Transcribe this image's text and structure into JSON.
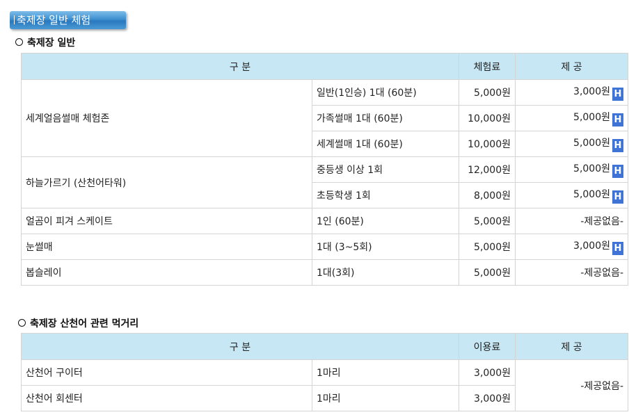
{
  "title": "축제장 일반 체험",
  "section1": {
    "heading": "축제장 일반",
    "headers": {
      "category": "구 분",
      "fee": "체험료",
      "offer": "제 공"
    },
    "groups": [
      {
        "name": "세계얼음썰매 체험존",
        "items": [
          {
            "detail": "일반(1인승) 1대 (60분)",
            "fee": "5,000원",
            "offer": "3,000원",
            "badge": "H"
          },
          {
            "detail": "가족썰매 1대 (60분)",
            "fee": "10,000원",
            "offer": "5,000원",
            "badge": "H"
          },
          {
            "detail": "세계썰매 1대 (60분)",
            "fee": "10,000원",
            "offer": "5,000원",
            "badge": "H"
          }
        ]
      },
      {
        "name": "하늘가르기 (산천어타워)",
        "items": [
          {
            "detail": "중등생 이상 1회",
            "fee": "12,000원",
            "offer": "5,000원",
            "badge": "H"
          },
          {
            "detail": "초등학생 1회",
            "fee": "8,000원",
            "offer": "5,000원",
            "badge": "H"
          }
        ]
      },
      {
        "name": "얼곰이 피겨 스케이트",
        "items": [
          {
            "detail": "1인 (60분)",
            "fee": "5,000원",
            "offer": "-제공없음-"
          }
        ]
      },
      {
        "name": "눈썰매",
        "items": [
          {
            "detail": "1대 (3~5회)",
            "fee": "5,000원",
            "offer": "3,000원",
            "badge": "H"
          }
        ]
      },
      {
        "name": "봅슬레이",
        "items": [
          {
            "detail": "1대(3회)",
            "fee": "5,000원",
            "offer": "-제공없음-"
          }
        ]
      }
    ]
  },
  "section2": {
    "heading": "축제장 산천어 관련 먹거리",
    "headers": {
      "category": "구 분",
      "fee": "이용료",
      "offer": "제 공"
    },
    "rows": [
      {
        "name": "산천어 구이터",
        "detail": "1마리",
        "fee": "3,000원"
      },
      {
        "name": "산천어 회센터",
        "detail": "1마리",
        "fee": "3,000원"
      }
    ],
    "offer": "-제공없음-"
  }
}
